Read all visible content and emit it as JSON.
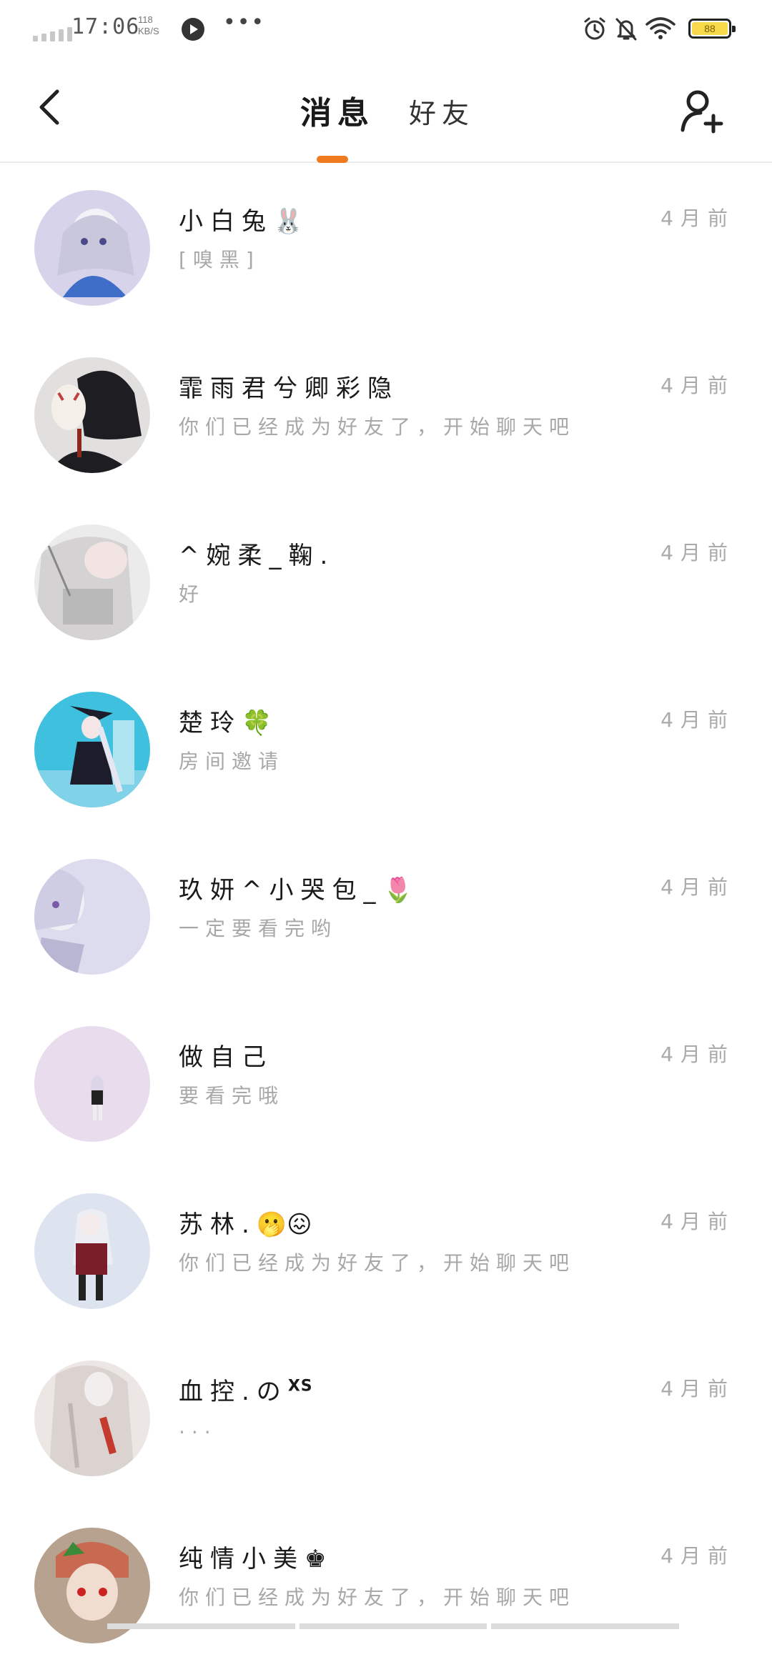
{
  "status_bar": {
    "time": "17:06",
    "net_speed_value": "118",
    "net_speed_unit": "KB/S",
    "more": "•••",
    "battery_level": "88"
  },
  "header": {
    "tabs": [
      {
        "label": "消息",
        "active": true
      },
      {
        "label": "好友",
        "active": false
      }
    ],
    "accent_color": "#f07a1e"
  },
  "conversations": [
    {
      "name": "小白兔",
      "emoji": "🐰",
      "preview": "[嗅黑]",
      "time": "4月前",
      "avatar_color": "#d7d3ea"
    },
    {
      "name": "霏雨君兮卿彩隐",
      "emoji": "",
      "preview": "你们已经成为好友了，开始聊天吧",
      "time": "4月前",
      "avatar_color": "#2b2b2e"
    },
    {
      "name": "^婉柔_鞠.",
      "emoji": "",
      "preview": "好",
      "time": "4月前",
      "avatar_color": "#e6e3e3"
    },
    {
      "name": "楚玲",
      "emoji": "🍀",
      "preview": "房间邀请",
      "time": "4月前",
      "avatar_color": "#3ec0de"
    },
    {
      "name": "玖妍^小哭包_",
      "emoji": "🌷",
      "preview": "一定要看完哟",
      "time": "4月前",
      "avatar_color": "#dcdcee"
    },
    {
      "name": "做自己",
      "emoji": "",
      "preview": "要看完哦",
      "time": "4月前",
      "avatar_color": "#e8dced"
    },
    {
      "name": "苏林.",
      "emoji": "🫢😖",
      "preview": "你们已经成为好友了，开始聊天吧",
      "time": "4月前",
      "avatar_color": "#dde4ef"
    },
    {
      "name": "血控.の",
      "emoji": "XS",
      "preview": "...",
      "time": "4月前",
      "avatar_color": "#ece7e4"
    },
    {
      "name": "纯情小美",
      "emoji": "♚",
      "preview": "你们已经成为好友了，开始聊天吧",
      "time": "4月前",
      "avatar_color": "#c86a52"
    }
  ]
}
